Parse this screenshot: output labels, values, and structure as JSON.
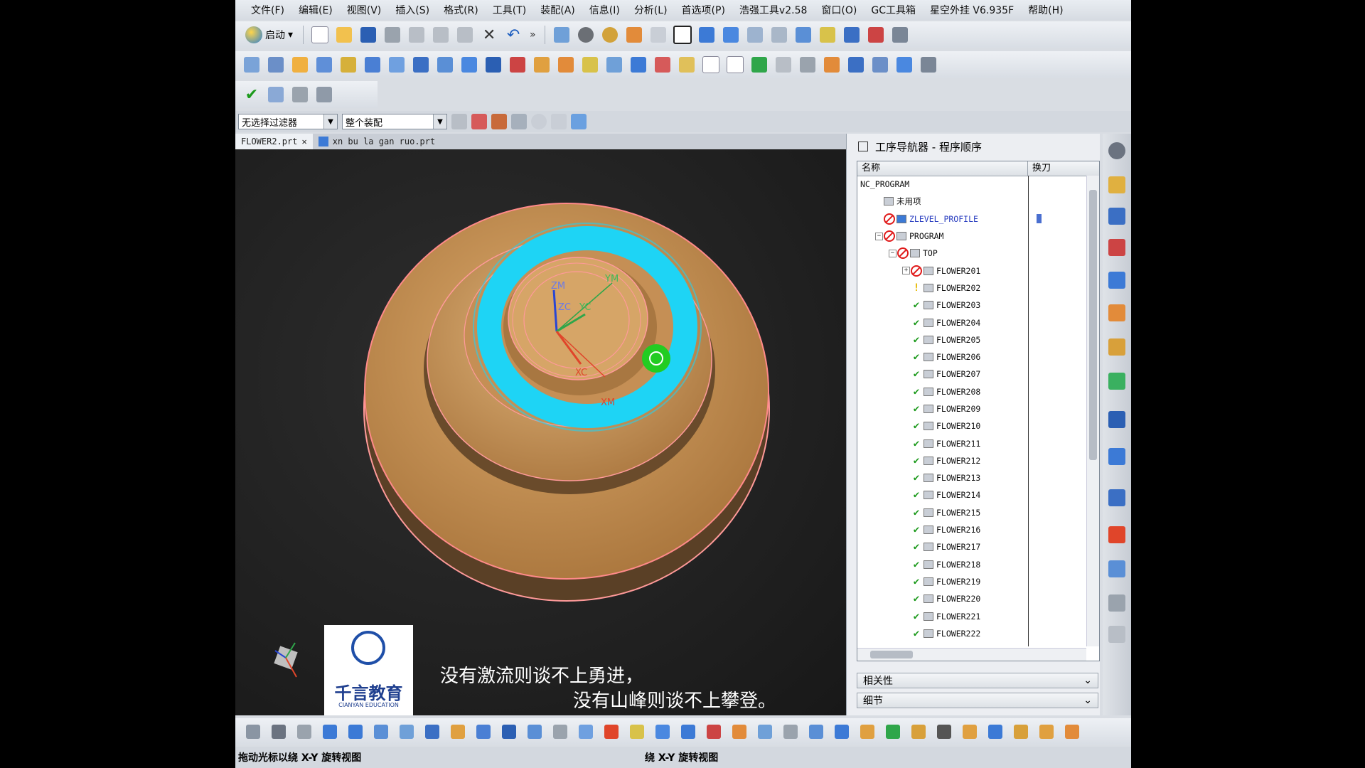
{
  "menu": [
    "文件(F)",
    "编辑(E)",
    "视图(V)",
    "插入(S)",
    "格式(R)",
    "工具(T)",
    "装配(A)",
    "信息(I)",
    "分析(L)",
    "首选项(P)",
    "浩强工具v2.58",
    "窗口(O)",
    "GC工具箱",
    "星空外挂 V6.935F",
    "帮助(H)"
  ],
  "toolbar": {
    "start_label": "启动",
    "more": "»"
  },
  "filter": {
    "selection_filter": "无选择过滤器",
    "assembly_scope": "整个装配"
  },
  "tabs": [
    {
      "label": "FLOWER2.prt",
      "active": true
    },
    {
      "label": "xn bu la gan ruo.prt",
      "active": false
    }
  ],
  "viewport": {
    "axis_labels": {
      "zm": "ZM",
      "zc": "ZC",
      "ym": "YM",
      "yc": "YC",
      "xc": "XC",
      "xm": "XM"
    },
    "caption_line1": "没有激流则谈不上勇进，",
    "caption_line2": "没有山峰则谈不上攀登。",
    "logo_text": "千言教育",
    "logo_subtext": "CIANYAN EDUCATION"
  },
  "navigator": {
    "title": "工序导航器 - 程序顺序",
    "col_name": "名称",
    "col_tool_change": "换刀",
    "rows": [
      {
        "label": "NC_PROGRAM",
        "level": 0,
        "status": "none",
        "expander": ""
      },
      {
        "label": "未用项",
        "level": 1,
        "status": "none",
        "expander": ""
      },
      {
        "label": "ZLEVEL_PROFILE",
        "level": 1,
        "status": "blocked",
        "expander": "",
        "op": true
      },
      {
        "label": "PROGRAM",
        "level": 1,
        "status": "blocked",
        "expander": "−"
      },
      {
        "label": "TOP",
        "level": 2,
        "status": "blocked",
        "expander": "−"
      },
      {
        "label": "FLOWER201",
        "level": 3,
        "status": "blocked",
        "expander": "+"
      },
      {
        "label": "FLOWER202",
        "level": 3,
        "status": "pending",
        "expander": ""
      },
      {
        "label": "FLOWER203",
        "level": 3,
        "status": "ok",
        "expander": ""
      },
      {
        "label": "FLOWER204",
        "level": 3,
        "status": "ok",
        "expander": ""
      },
      {
        "label": "FLOWER205",
        "level": 3,
        "status": "ok",
        "expander": ""
      },
      {
        "label": "FLOWER206",
        "level": 3,
        "status": "ok",
        "expander": ""
      },
      {
        "label": "FLOWER207",
        "level": 3,
        "status": "ok",
        "expander": ""
      },
      {
        "label": "FLOWER208",
        "level": 3,
        "status": "ok",
        "expander": ""
      },
      {
        "label": "FLOWER209",
        "level": 3,
        "status": "ok",
        "expander": ""
      },
      {
        "label": "FLOWER210",
        "level": 3,
        "status": "ok",
        "expander": ""
      },
      {
        "label": "FLOWER211",
        "level": 3,
        "status": "ok",
        "expander": ""
      },
      {
        "label": "FLOWER212",
        "level": 3,
        "status": "ok",
        "expander": ""
      },
      {
        "label": "FLOWER213",
        "level": 3,
        "status": "ok",
        "expander": ""
      },
      {
        "label": "FLOWER214",
        "level": 3,
        "status": "ok",
        "expander": ""
      },
      {
        "label": "FLOWER215",
        "level": 3,
        "status": "ok",
        "expander": ""
      },
      {
        "label": "FLOWER216",
        "level": 3,
        "status": "ok",
        "expander": ""
      },
      {
        "label": "FLOWER217",
        "level": 3,
        "status": "ok",
        "expander": ""
      },
      {
        "label": "FLOWER218",
        "level": 3,
        "status": "ok",
        "expander": ""
      },
      {
        "label": "FLOWER219",
        "level": 3,
        "status": "ok",
        "expander": ""
      },
      {
        "label": "FLOWER220",
        "level": 3,
        "status": "ok",
        "expander": ""
      },
      {
        "label": "FLOWER221",
        "level": 3,
        "status": "ok",
        "expander": ""
      },
      {
        "label": "FLOWER222",
        "level": 3,
        "status": "ok",
        "expander": ""
      }
    ],
    "sections": [
      "相关性",
      "细节"
    ]
  },
  "status": {
    "left": "拖动光标以绕 X-Y 旋转视图",
    "center": "绕 X-Y 旋转视图"
  },
  "colors": {
    "part": "#c8955a",
    "toolpath": "#1ed4f5",
    "edge": "#ff8a8a",
    "cursor": "#22cc22"
  }
}
